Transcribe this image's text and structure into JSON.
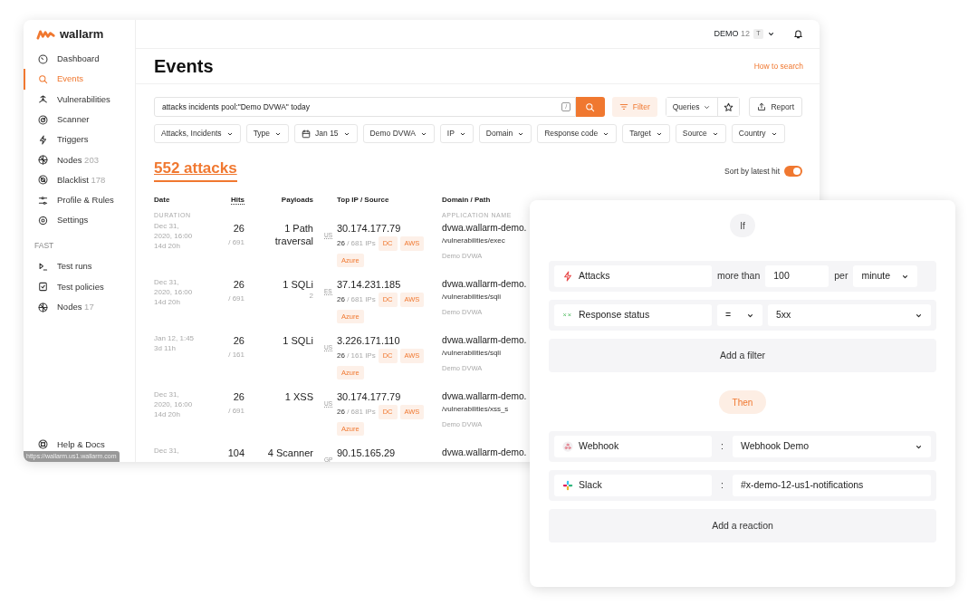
{
  "app": {
    "brand": "wallarm",
    "account": {
      "name": "DEMO",
      "number": "12",
      "avatar": "T"
    },
    "sidebar": {
      "items": [
        {
          "label": "Dashboard",
          "selected": false
        },
        {
          "label": "Events",
          "selected": true
        },
        {
          "label": "Vulnerabilities",
          "selected": false
        },
        {
          "label": "Scanner",
          "selected": false
        },
        {
          "label": "Triggers",
          "selected": false
        },
        {
          "label": "Nodes",
          "count": "203",
          "selected": false
        },
        {
          "label": "Blacklist",
          "count": "178",
          "selected": false
        },
        {
          "label": "Profile & Rules",
          "selected": false
        },
        {
          "label": "Settings",
          "selected": false
        }
      ],
      "section_title": "FAST",
      "fast_items": [
        {
          "label": "Test runs",
          "selected": false
        },
        {
          "label": "Test policies",
          "selected": false
        },
        {
          "label": "Nodes",
          "count": "17",
          "selected": false
        }
      ],
      "footer": "Help & Docs"
    },
    "page_title": "Events",
    "help_link": "How to search",
    "search": {
      "value": "attacks incidents pool:\"Demo DVWA\" today",
      "shortcut": "/"
    },
    "toolbar": {
      "filter": "Filter",
      "queries": "Queries",
      "report": "Report"
    },
    "filters": [
      {
        "label": "Attacks, Incidents",
        "kind": "plain"
      },
      {
        "label": "Type",
        "kind": "plain"
      },
      {
        "label": "Jan 15",
        "kind": "date"
      },
      {
        "label": "Demo DVWA",
        "kind": "plain"
      },
      {
        "label": "IP",
        "kind": "plain"
      },
      {
        "label": "Domain",
        "kind": "plain"
      },
      {
        "label": "Response code",
        "kind": "plain"
      },
      {
        "label": "Target",
        "kind": "plain"
      },
      {
        "label": "Source",
        "kind": "plain"
      },
      {
        "label": "Country",
        "kind": "plain"
      }
    ],
    "count_tab": "552 attacks",
    "sort": {
      "label": "Sort by latest hit",
      "on": true
    },
    "columns": [
      {
        "title": "Date",
        "subtitle": "DURATION"
      },
      {
        "title": "Hits"
      },
      {
        "title": "Payloads"
      },
      {
        "title": "Top IP / Source"
      },
      {
        "title": "Domain / Path",
        "subtitle": "APPLICATION NAME"
      }
    ],
    "rows": [
      {
        "date": "Dec 31, 2020, 16:00",
        "duration": "14d 20h",
        "hits": "26",
        "hits_total": "/ 691",
        "payload": "1 Path traversal",
        "country": "US",
        "ip": "30.174.177.79",
        "ip_hits": "26",
        "ip_total": "/ 681 IPs",
        "tags": [
          "DC",
          "AWS",
          "Azure"
        ],
        "domain": "dvwa.wallarm-demo.",
        "path": "/vulnerabilities/exec",
        "app": "Demo DVWA"
      },
      {
        "date": "Dec 31, 2020, 16:00",
        "duration": "14d 20h",
        "hits": "26",
        "hits_total": "/ 691",
        "payload": "1 SQLi",
        "payload_count": "2",
        "country": "ES",
        "ip": "37.14.231.185",
        "ip_hits": "26",
        "ip_total": "/ 681 IPs",
        "tags": [
          "DC",
          "AWS",
          "Azure"
        ],
        "domain": "dvwa.wallarm-demo.",
        "path": "/vulnerabilities/sqli",
        "app": "Demo DVWA"
      },
      {
        "date": "Jan 12, 1:45",
        "duration": "3d 11h",
        "hits": "26",
        "hits_total": "/ 161",
        "payload": "1 SQLi",
        "country": "US",
        "ip": "3.226.171.110",
        "ip_hits": "26",
        "ip_total": "/ 161 IPs",
        "tags": [
          "DC",
          "AWS",
          "Azure"
        ],
        "domain": "dvwa.wallarm-demo.",
        "path": "/vulnerabilities/sqli",
        "app": "Demo DVWA"
      },
      {
        "date": "Dec 31, 2020, 16:00",
        "duration": "14d 20h",
        "hits": "26",
        "hits_total": "/ 691",
        "payload": "1 XSS",
        "country": "US",
        "ip": "30.174.177.79",
        "ip_hits": "26",
        "ip_total": "/ 681 IPs",
        "tags": [
          "DC",
          "AWS",
          "Azure"
        ],
        "domain": "dvwa.wallarm-demo.",
        "path": "/vulnerabilities/xss_s",
        "app": "Demo DVWA"
      },
      {
        "date": "Dec 31,",
        "hits": "104",
        "payload": "4 Scanner",
        "country": "GP",
        "ip": "90.15.165.29",
        "domain": "dvwa.wallarm-demo."
      }
    ],
    "status_url": "https://wallarm.us1.wallarm.com"
  },
  "trigger": {
    "if_label": "If",
    "then_label": "Then",
    "conditions": [
      {
        "kind": "threshold",
        "event": "Attacks",
        "operator": "more than",
        "value": "100",
        "unit_label": "per",
        "unit": "minute"
      },
      {
        "kind": "compare",
        "event": "Response status",
        "operator": "=",
        "value": "5xx"
      }
    ],
    "add_condition": "Add a filter",
    "reactions": [
      {
        "kind": "select",
        "channel": "Webhook",
        "separator": ":",
        "target": "Webhook Demo"
      },
      {
        "kind": "text",
        "channel": "Slack",
        "separator": ":",
        "target": "#x-demo-12-us1-notifications"
      }
    ],
    "add_reaction": "Add a reaction"
  }
}
